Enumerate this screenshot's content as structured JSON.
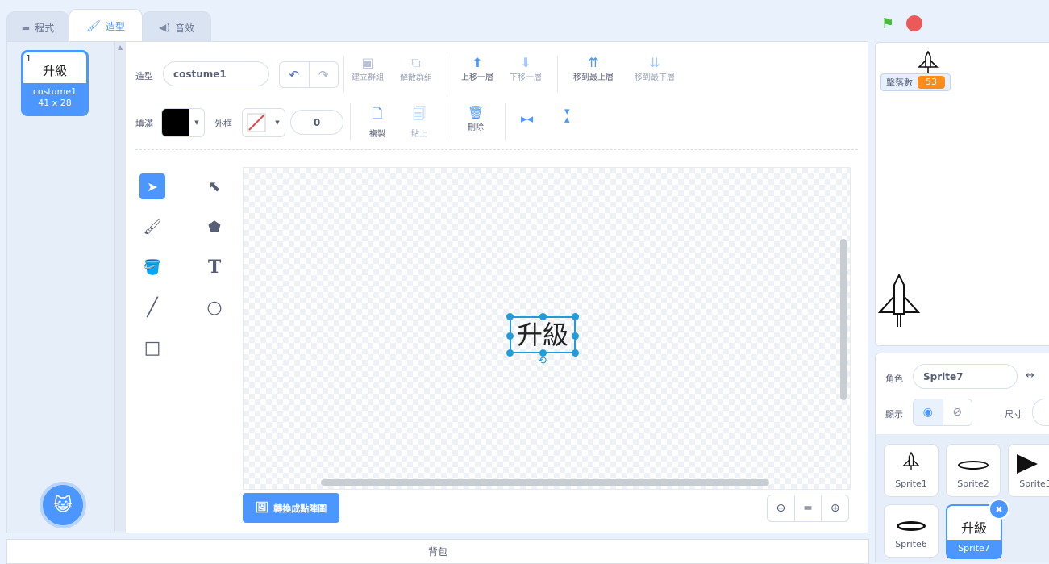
{
  "tabs": [
    {
      "label": "程式",
      "icon": "code-icon"
    },
    {
      "label": "造型",
      "icon": "brush-icon"
    },
    {
      "label": "音效",
      "icon": "speaker-icon"
    }
  ],
  "costume_list": [
    {
      "number": "1",
      "preview": "升級",
      "name": "costume1",
      "size": "41 x 28"
    }
  ],
  "toolbar": {
    "costume_label": "造型",
    "costume_name": "costume1",
    "group": "建立群組",
    "ungroup": "解散群組",
    "forward": "上移一層",
    "backward": "下移一層",
    "front": "移到最上層",
    "back": "移到最下層",
    "fill_label": "填滿",
    "fill_color": "#000000",
    "outline_label": "外框",
    "outline_width": "0",
    "copy": "複製",
    "paste": "貼上",
    "delete": "刪除"
  },
  "canvas": {
    "text": "升級",
    "convert_button": "轉換成點陣圖",
    "zoom_equal": "="
  },
  "stage": {
    "monitor_label": "擊落數",
    "monitor_value": "53"
  },
  "sprite_info": {
    "sprite_label": "角色",
    "sprite_name": "Sprite7",
    "show_label": "顯示",
    "size_label": "尺寸"
  },
  "sprites": [
    {
      "name": "Sprite1",
      "icon": "rocket-icon"
    },
    {
      "name": "Sprite2",
      "icon": "oval-icon"
    },
    {
      "name": "Sprite3",
      "icon": "arrow-icon"
    },
    {
      "name": "Sprite6",
      "icon": "oval-icon"
    },
    {
      "name": "Sprite7",
      "preview": "升級"
    }
  ],
  "backpack": "背包",
  "colors": {
    "accent": "#4c97ff",
    "monitor": "#ff8c1a",
    "green_flag": "#45bd35",
    "stop": "#ec5959"
  }
}
